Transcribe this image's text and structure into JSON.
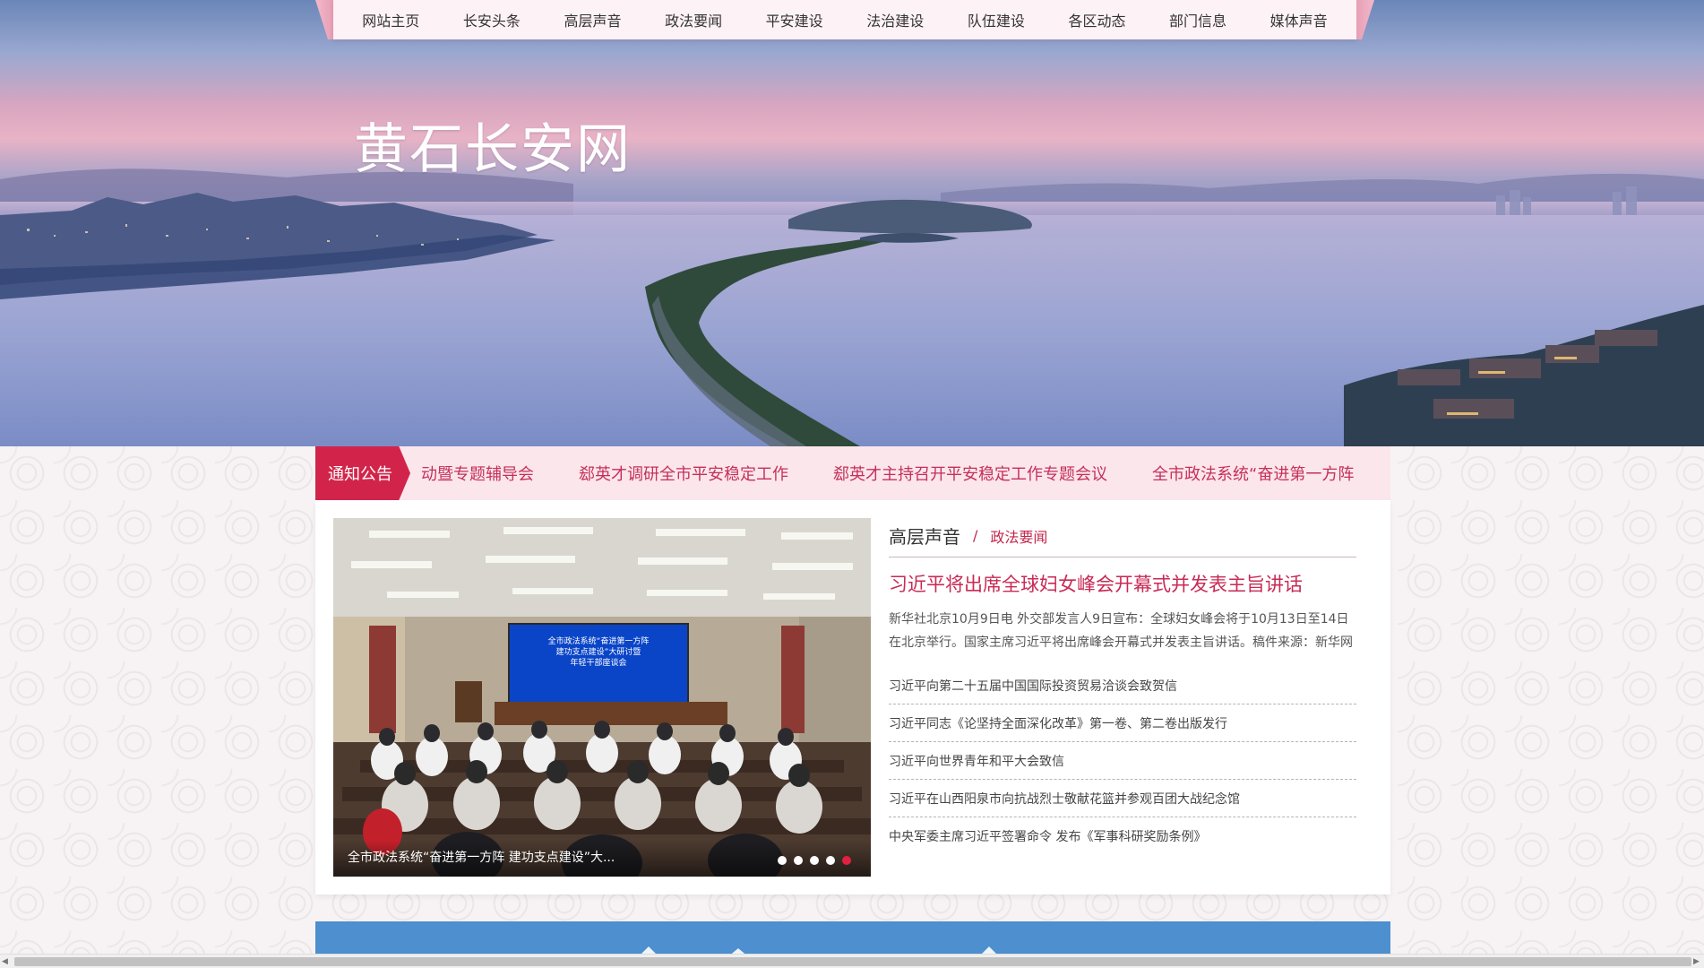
{
  "nav": {
    "items": [
      "网站主页",
      "长安头条",
      "高层声音",
      "政法要闻",
      "平安建设",
      "法治建设",
      "队伍建设",
      "各区动态",
      "部门信息",
      "媒体声音"
    ]
  },
  "hero": {
    "site_title": "黄石长安网"
  },
  "notice": {
    "tag": "通知公告",
    "items": [
      "动暨专题辅导会",
      "郄英才调研全市平安稳定工作",
      "郄英才主持召开平安稳定工作专题会议",
      "全市政法系统“奋进第一方阵"
    ]
  },
  "slideshow": {
    "caption": "全市政法系统“奋进第一方阵 建功支点建设”大...",
    "screen_text": [
      "全市政法系统“奋进第一方阵",
      "建功支点建设”大研讨暨",
      "年轻干部座谈会"
    ],
    "dots": 5,
    "active_dot": 5
  },
  "news": {
    "tab_active": "高层声音",
    "tab_sep": "/",
    "tab_other": "政法要闻",
    "headline": "习近平将出席全球妇女峰会开幕式并发表主旨讲话",
    "summary": "新华社北京10月9日电 外交部发言人9日宣布：全球妇女峰会将于10月13日至14日在北京举行。国家主席习近平将出席峰会开幕式并发表主旨讲话。稿件来源：新华网",
    "list": [
      "习近平向第二十五届中国国际投资贸易洽谈会致贺信",
      "习近平同志《论坚持全面深化改革》第一卷、第二卷出版发行",
      "习近平向世界青年和平大会致信",
      "习近平在山西阳泉市向抗战烈士敬献花篮并参观百团大战纪念馆",
      "中央军委主席习近平签署命令 发布《军事科研奖励条例》"
    ]
  },
  "colors": {
    "accent": "#d2244a",
    "accent_text": "#c5305a",
    "banner_blue": "#4d8fcf"
  }
}
